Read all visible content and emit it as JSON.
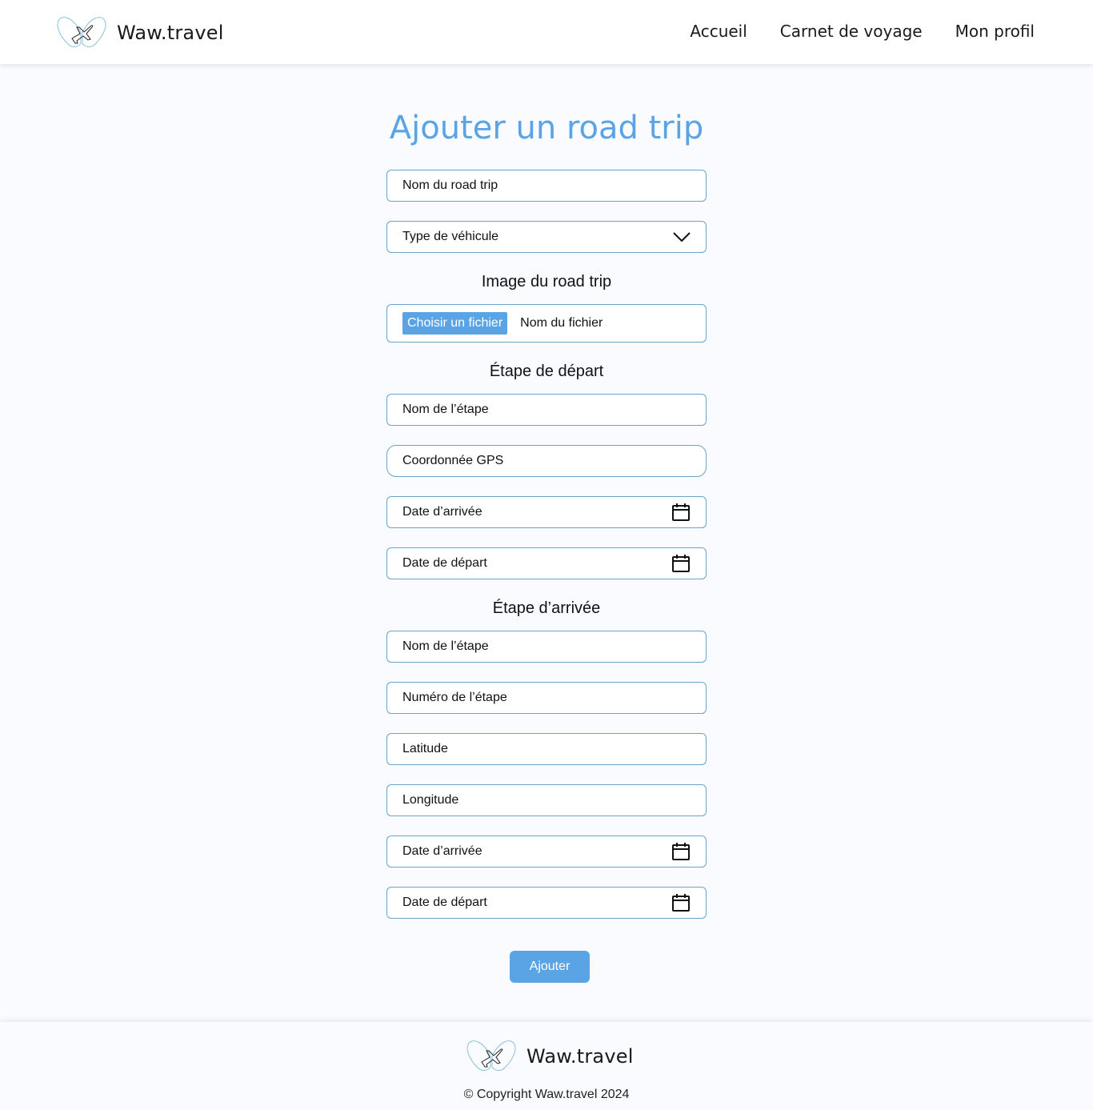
{
  "brand": {
    "name": "Waw.travel",
    "accent_color": "#5aa4e6"
  },
  "nav": {
    "items": [
      "Accueil",
      "Carnet de voyage",
      "Mon profil"
    ]
  },
  "form": {
    "title": "Ajouter un road trip",
    "roadtrip_name_placeholder": "Nom du road trip",
    "vehicle_select_value": "Type de véhicule",
    "image_section_title": "Image du road trip",
    "file_button_label": "Choisir un fichier",
    "file_name_placeholder": "Nom du fichier",
    "start_stage": {
      "title": "Étape de départ",
      "name_placeholder": "Nom de l’étape",
      "gps_placeholder": "Coordonnée GPS",
      "arrival_date_placeholder": "Date d’arrivée",
      "departure_date_placeholder": "Date de départ"
    },
    "end_stage": {
      "title": "Étape d’arrivée",
      "name_placeholder": "Nom de l’étape",
      "number_placeholder": "Numéro de l’étape",
      "latitude_placeholder": "Latitude",
      "longitude_placeholder": "Longitude",
      "arrival_date_placeholder": "Date d’arrivée",
      "departure_date_placeholder": "Date de départ"
    },
    "submit_label": "Ajouter"
  },
  "footer": {
    "brand_name": "Waw.travel",
    "copyright": "© Copyright Waw.travel 2024"
  },
  "icons": {
    "logo": "butterfly-airplane-logo-icon",
    "select_arrow": "chevron-down-icon",
    "date": "calendar-icon"
  }
}
